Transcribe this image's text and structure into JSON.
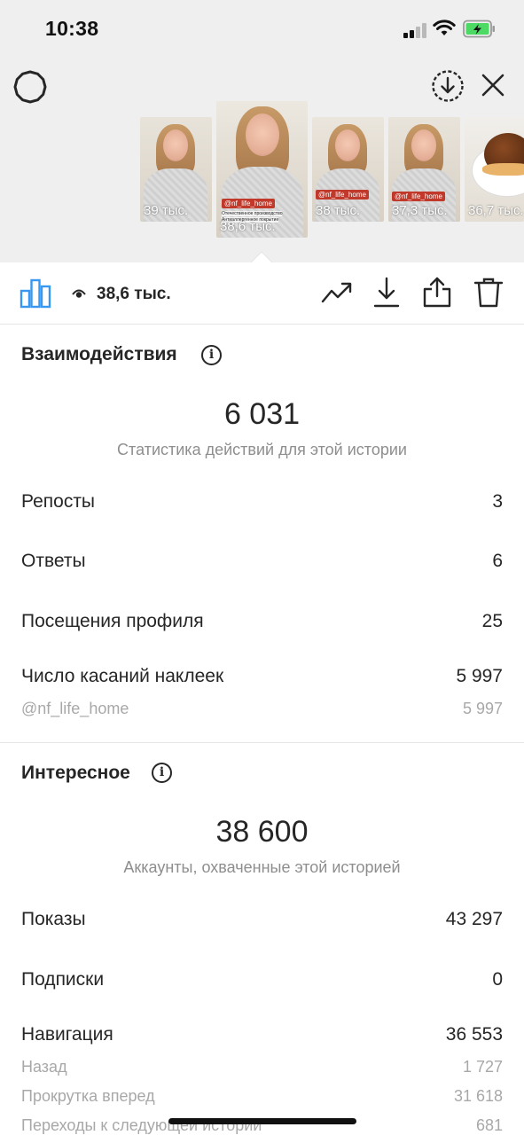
{
  "status_bar": {
    "time": "10:38"
  },
  "thumbnails": [
    {
      "views": "39 тыс."
    },
    {
      "views": "38,6 тыс.",
      "tag": "@nf_life_home",
      "tag_sub": "Отечественное производство",
      "tag_sub2": "Антиаллергенное покрытие"
    },
    {
      "views": "38 тыс.",
      "tag": "@nf_life_home"
    },
    {
      "views": "37,3 тыс.",
      "tag": "@nf_life_home"
    },
    {
      "views": "36,7 тыс."
    }
  ],
  "toolbar": {
    "views": "38,6 тыс."
  },
  "interactions": {
    "title": "Взаимодействия",
    "total": "6 031",
    "caption": "Статистика действий для этой истории",
    "rows": [
      {
        "label": "Репосты",
        "value": "3"
      },
      {
        "label": "Ответы",
        "value": "6"
      },
      {
        "label": "Посещения профиля",
        "value": "25"
      },
      {
        "label": "Число касаний наклеек",
        "value": "5 997"
      }
    ],
    "sub_rows": [
      {
        "label": "@nf_life_home",
        "value": "5 997"
      }
    ]
  },
  "discovery": {
    "title": "Интересное",
    "total": "38 600",
    "caption": "Аккаунты, охваченные этой историей",
    "rows": [
      {
        "label": "Показы",
        "value": "43 297"
      },
      {
        "label": "Подписки",
        "value": "0"
      },
      {
        "label": "Навигация",
        "value": "36 553"
      }
    ],
    "sub_rows": [
      {
        "label": "Назад",
        "value": "1 727"
      },
      {
        "label": "Прокрутка вперед",
        "value": "31 618"
      },
      {
        "label": "Переходы к следующей истории",
        "value": "681"
      }
    ]
  },
  "colors": {
    "accent": "#3897f0",
    "text": "#262626",
    "muted": "#8e8e8e",
    "tag": "#c0392b"
  }
}
